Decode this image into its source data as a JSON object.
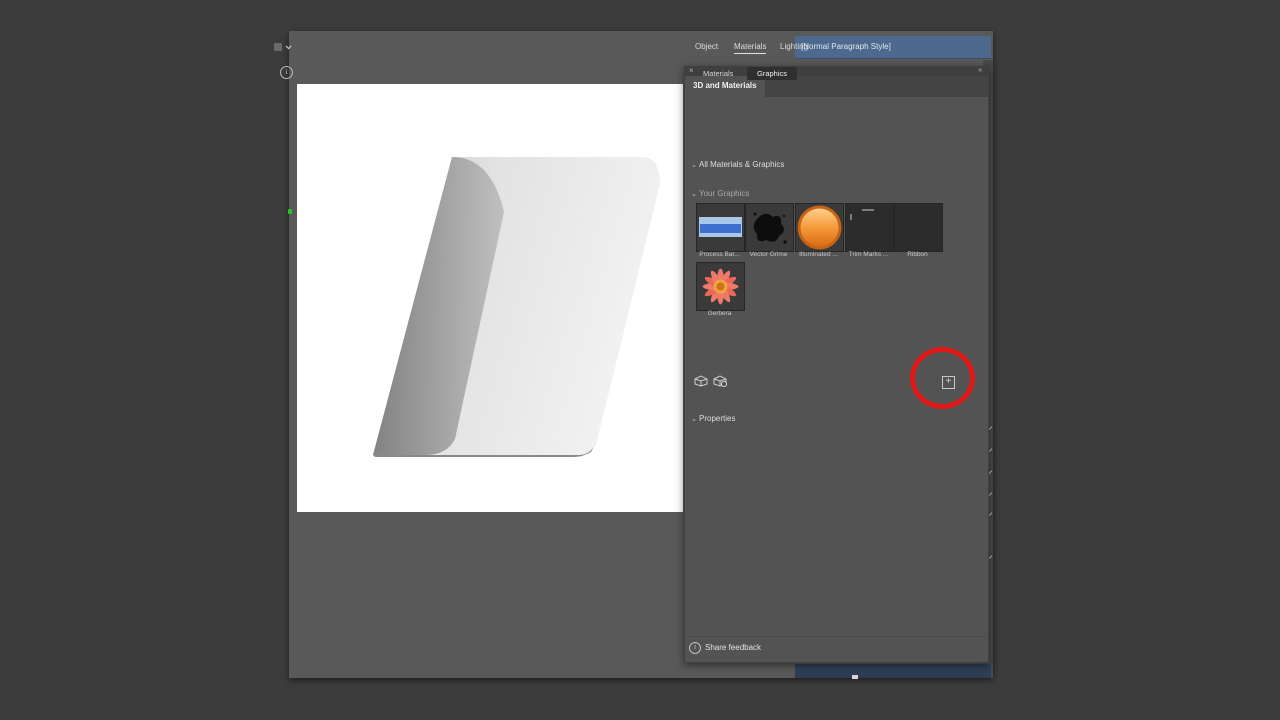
{
  "paragraph_styles": {
    "item": "[Normal Paragraph Style]"
  },
  "panel": {
    "title": "3D and Materials",
    "close_glyph": "×",
    "collapse_glyph": "«",
    "tabs": [
      "Object",
      "Materials",
      "Lighting"
    ],
    "active_tab": "Materials",
    "subtoggles": [
      "Materials",
      "Graphics"
    ],
    "active_subtoggle": "Graphics",
    "info_glyph": "i",
    "sections": {
      "all": "All Materials & Graphics",
      "your_graphics": "Your Graphics",
      "properties": "Properties"
    },
    "chevron_glyph": "⌄",
    "graphics": [
      {
        "label": "Process Bar...",
        "icon": "process-bar-thumbnail"
      },
      {
        "label": "Vector Grime",
        "icon": "vector-grime-thumbnail"
      },
      {
        "label": "Illuminated ...",
        "icon": "illuminated-button-thumbnail"
      },
      {
        "label": "Trim Marks ...",
        "icon": "trim-marks-thumbnail"
      },
      {
        "label": "Ribbon",
        "icon": "ribbon-thumbnail"
      },
      {
        "label": "Gerbera",
        "icon": "gerbera-flower-thumbnail"
      }
    ],
    "add_glyph": "+",
    "feedback": "Share feedback"
  },
  "colors": {
    "canvas": "#595959",
    "panel": "#535353",
    "highlight": "#e21818",
    "paragraph_style_bar": "#4d6a8e"
  }
}
